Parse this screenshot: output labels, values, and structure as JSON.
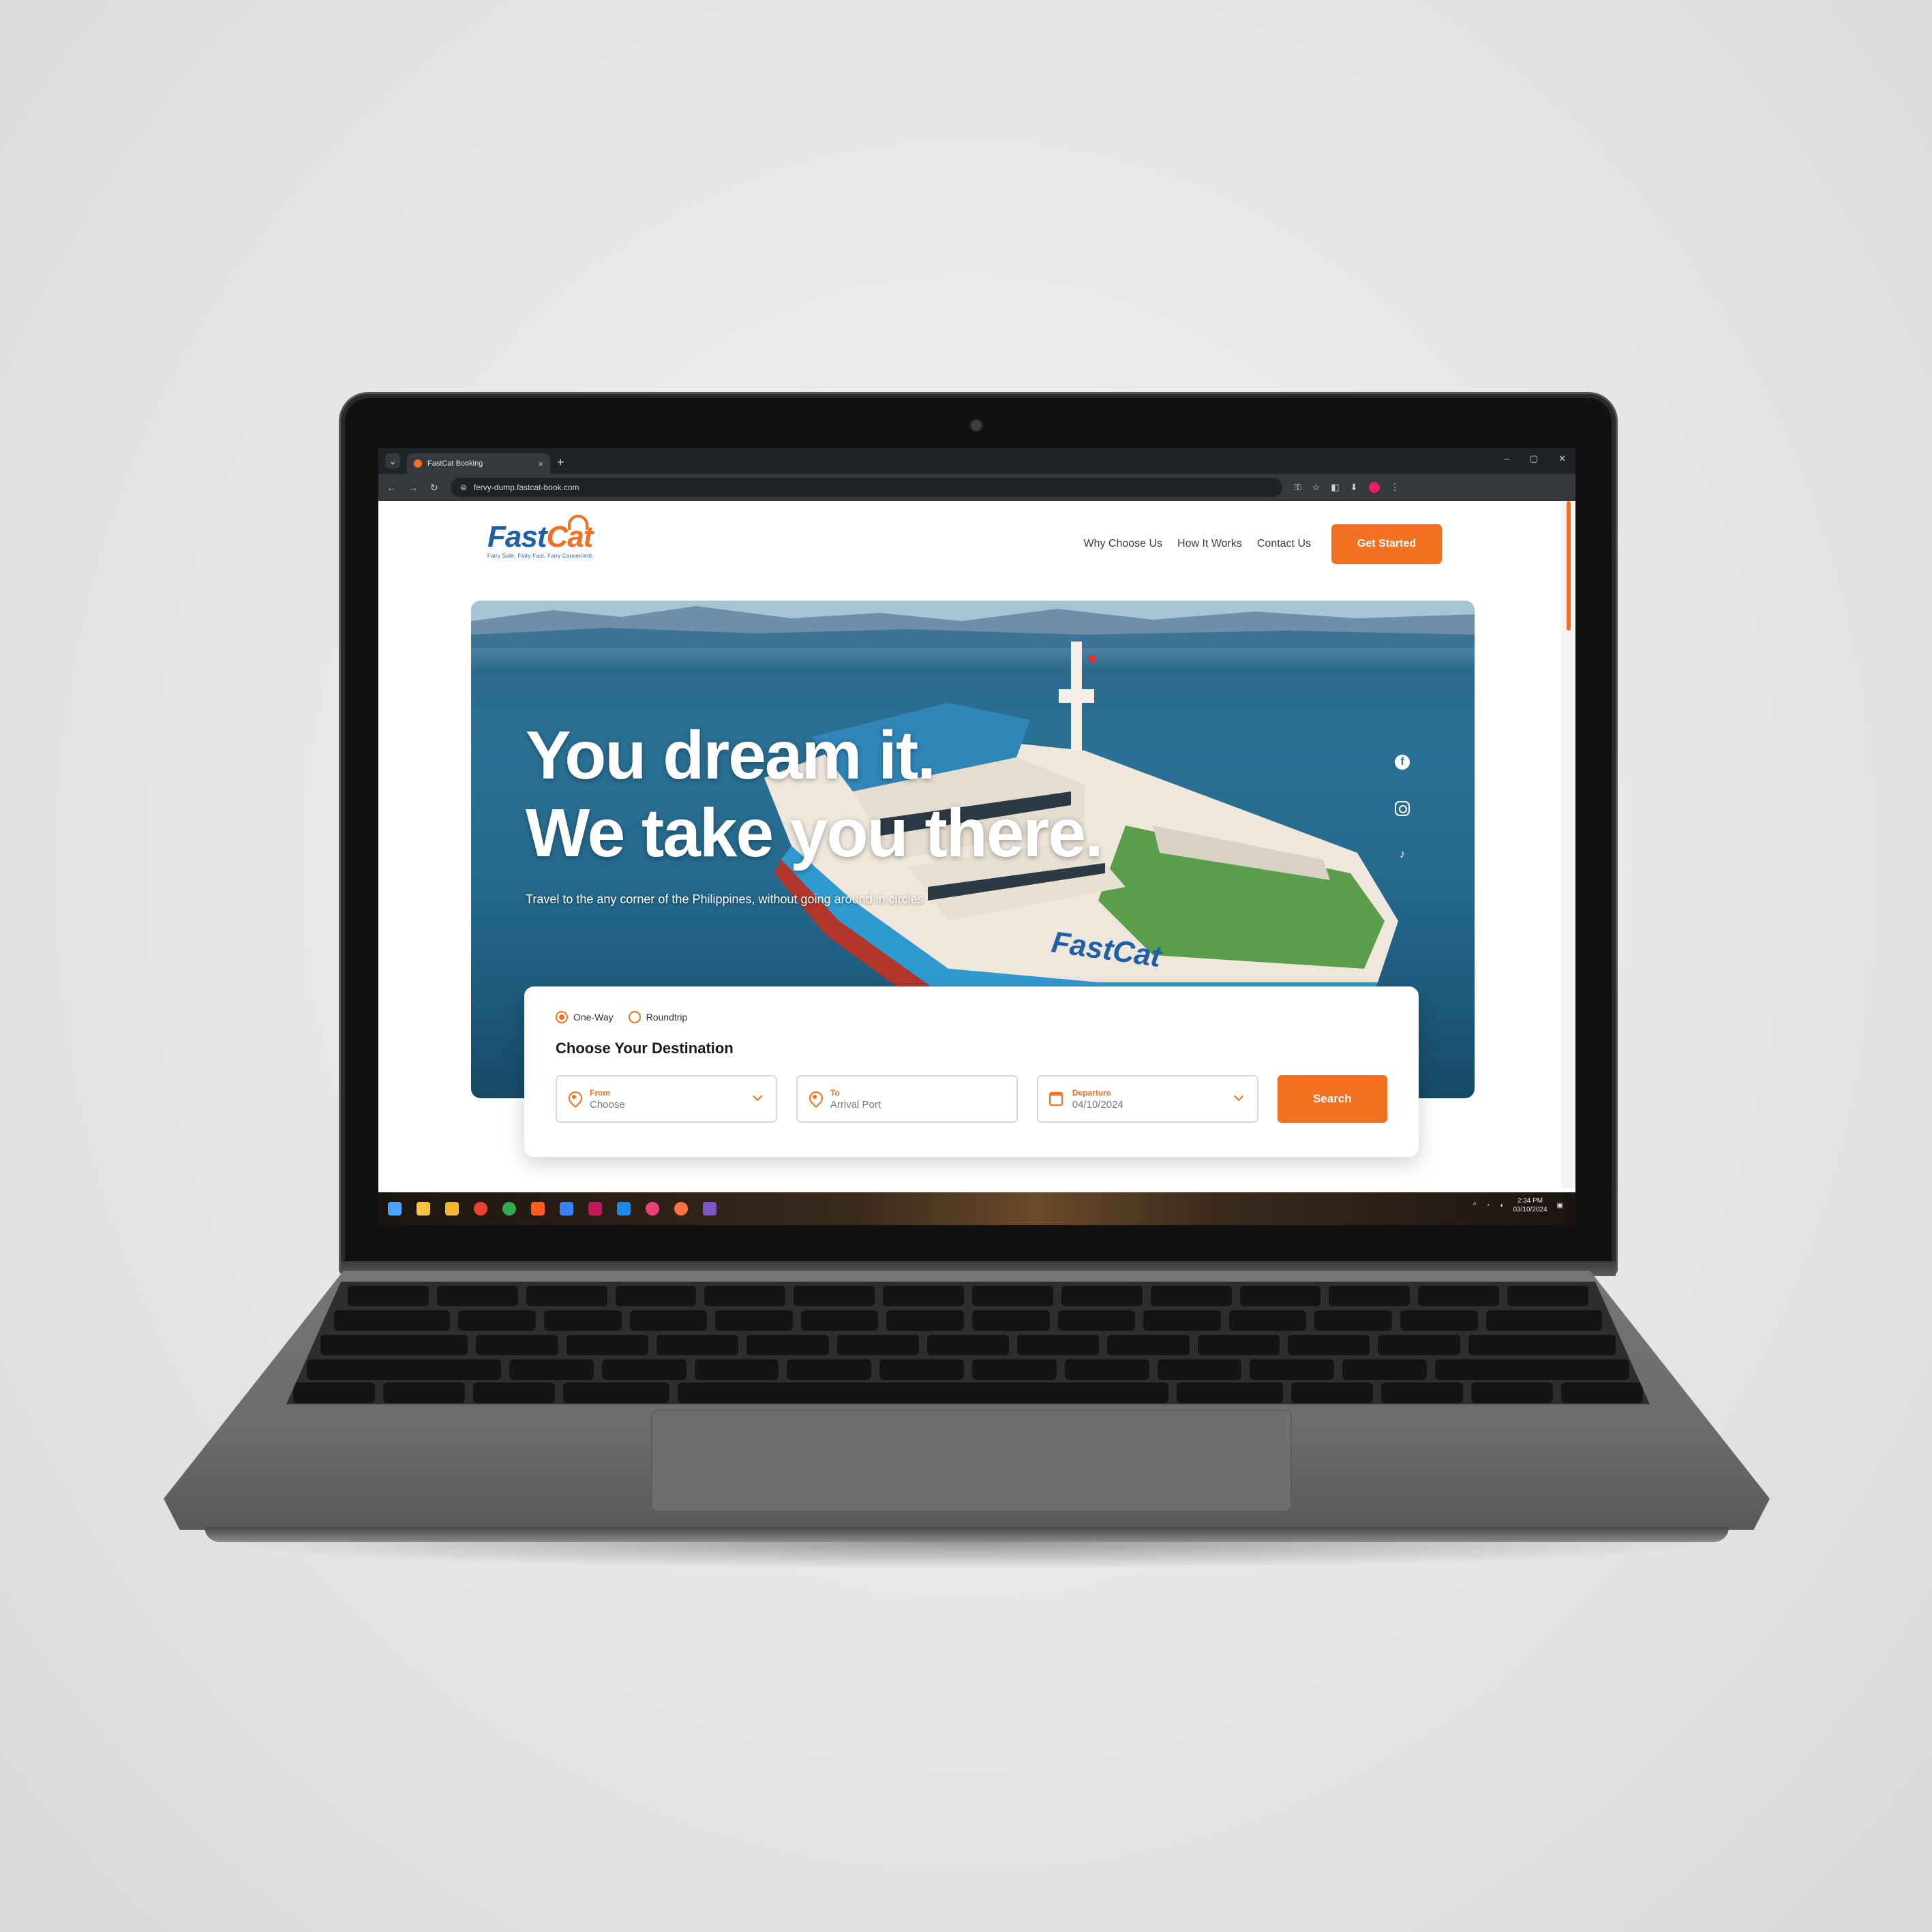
{
  "browser": {
    "tab_title": "FastCat Booking",
    "tab_close": "×",
    "new_tab": "+",
    "tab_menu": "⌄",
    "window_controls": [
      "–",
      "▢",
      "✕"
    ],
    "nav_buttons": [
      "←",
      "→",
      "↻"
    ],
    "url": "fervy-dump.fastcat-book.com",
    "extensions": [
      "⚿",
      "☆",
      "◧",
      "⬇",
      "⋮"
    ]
  },
  "header": {
    "logo_fast": "Fast",
    "logo_cat": "Cat",
    "logo_tagline": "Fairy Safe. Fairy Fast. Fairy Convenient.",
    "nav": [
      "Why Choose Us",
      "How It Works",
      "Contact Us"
    ],
    "cta": "Get Started"
  },
  "hero": {
    "headline_line1": "You dream it.",
    "headline_line2": "We take you there.",
    "subtitle": "Travel to the any corner of the Philippines, without going around in circles",
    "ship_brand": "FastCat",
    "social": [
      "facebook-icon",
      "instagram-icon",
      "tiktok-icon"
    ]
  },
  "booking": {
    "trip_types": [
      "One-Way",
      "Roundtrip"
    ],
    "selected_trip": "One-Way",
    "title": "Choose Your Destination",
    "from_label": "From",
    "from_value": "Choose",
    "to_label": "To",
    "to_value": "Arrival Port",
    "departure_label": "Departure",
    "departure_value": "04/10/2024",
    "search": "Search"
  },
  "taskbar": {
    "time": "2:34 PM",
    "date": "03/10/2024"
  },
  "colors": {
    "accent": "#f37021",
    "brand_blue": "#1d5fa8"
  }
}
